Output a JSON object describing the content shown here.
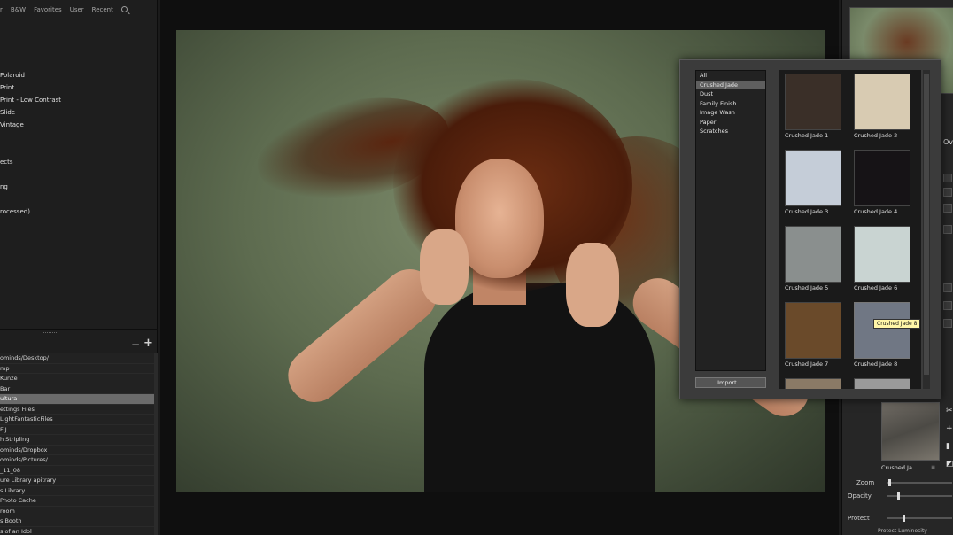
{
  "left_panel": {
    "tabs": [
      "r",
      "B&W",
      "Favorites",
      "User",
      "Recent"
    ],
    "presets": [
      "",
      "Polaroid",
      "Print",
      "Print - Low Contrast",
      "Slide",
      "Vintage",
      "",
      "",
      "ects",
      "",
      "ng",
      "",
      "rocessed)"
    ],
    "folders": [
      "ominds/Desktop/",
      "mp",
      "Kunze",
      "Bar",
      "ultura",
      "ettings Files",
      "LightFantasticFiles",
      "F J",
      "h Stripling",
      "ominds/Dropbox",
      "ominds/Pictures/",
      "_11_08",
      "ure Library apitrary",
      "s Library",
      "Photo Cache",
      "room",
      "s Booth",
      "s of an Idol"
    ],
    "selected_folder_index": 4,
    "minus_label": "−",
    "plus_label": "+"
  },
  "texture_browser": {
    "categories": [
      "All",
      "Crushed Jade",
      "Dust",
      "Family Finish",
      "Image Wash",
      "Paper",
      "Scratches"
    ],
    "selected_category_index": 1,
    "import_label": "Import ...",
    "tiles": [
      {
        "label": "Crushed Jade 1",
        "color": "#3a2f28"
      },
      {
        "label": "Crushed Jade 2",
        "color": "#d8cbb2"
      },
      {
        "label": "Crushed Jade 3",
        "color": "#c5cdd8"
      },
      {
        "label": "Crushed Jade 4",
        "color": "#161316"
      },
      {
        "label": "Crushed Jade 5",
        "color": "#8a8f8e"
      },
      {
        "label": "Crushed Jade 6",
        "color": "#c9d4d2"
      },
      {
        "label": "Crushed Jade 7",
        "color": "#6a4a2a"
      },
      {
        "label": "Crushed Jade 8",
        "color": "#707784"
      }
    ],
    "tooltip": "Crushed Jade 8"
  },
  "right_panel": {
    "ov_label": "Ov",
    "texture_preview_label": "Crushed Ja...",
    "texture_dropdown": "≡",
    "zoom_label": "Zoom",
    "opacity_label": "Opacity",
    "protect_label": "Protect",
    "footer_label": "Protect Luminosity"
  },
  "colors": {
    "panel_bg": "#1e1e1e",
    "canvas_bg": "#0f0f0f",
    "selection": "#6b6b6b",
    "tooltip_bg": "#fff6a8"
  }
}
